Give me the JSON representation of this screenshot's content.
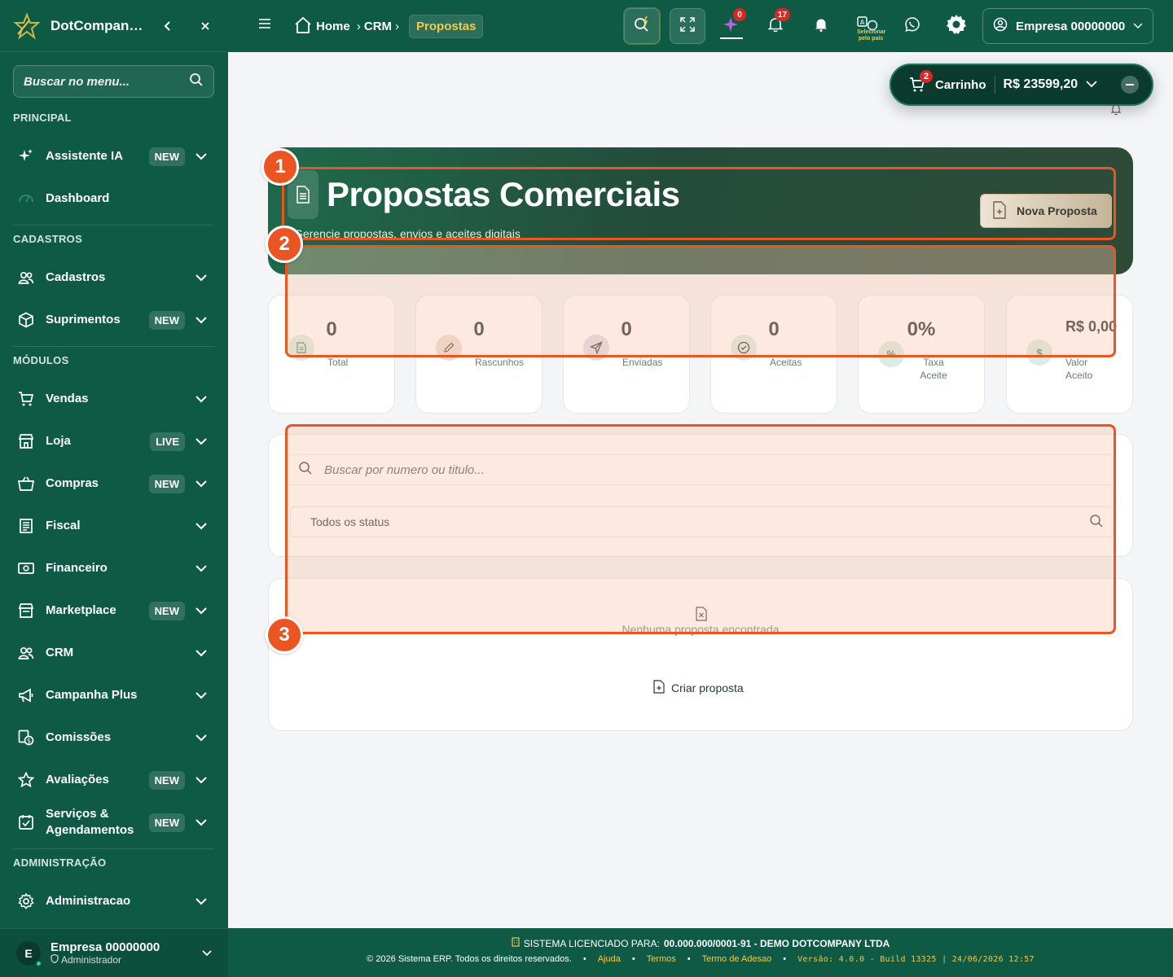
{
  "app": {
    "name": "DotCompany ERP",
    "collapse_icon": "chevron-left-icon",
    "close_icon": "close-icon"
  },
  "sidebar": {
    "search_placeholder": "Buscar no menu...",
    "sections": {
      "principal": "PRINCIPAL",
      "cadastros": "CADASTROS",
      "modulos": "MÓDULOS",
      "administracao": "ADMINISTRAÇÃO"
    },
    "items": [
      {
        "label": "Assistente IA",
        "badge": "NEW",
        "icon": "sparkle-icon"
      },
      {
        "label": "Dashboard",
        "badge": "",
        "icon": "gauge-icon"
      },
      {
        "label": "Cadastros",
        "badge": "",
        "icon": "users-icon"
      },
      {
        "label": "Suprimentos",
        "badge": "NEW",
        "icon": "box-icon"
      },
      {
        "label": "Vendas",
        "badge": "",
        "icon": "cart-icon"
      },
      {
        "label": "Loja",
        "badge": "LIVE",
        "icon": "store-icon"
      },
      {
        "label": "Compras",
        "badge": "NEW",
        "icon": "basket-icon"
      },
      {
        "label": "Fiscal",
        "badge": "",
        "icon": "receipt-icon"
      },
      {
        "label": "Financeiro",
        "badge": "",
        "icon": "cash-icon"
      },
      {
        "label": "Marketplace",
        "badge": "NEW",
        "icon": "shop-icon"
      },
      {
        "label": "CRM",
        "badge": "",
        "icon": "contacts-icon"
      },
      {
        "label": "Campanha Plus",
        "badge": "",
        "icon": "megaphone-icon"
      },
      {
        "label": "Comissões",
        "badge": "",
        "icon": "commission-icon"
      },
      {
        "label": "Avaliações",
        "badge": "NEW",
        "icon": "star-icon"
      },
      {
        "label": "Serviços & Agendamentos",
        "badge": "NEW",
        "icon": "calendar-icon"
      },
      {
        "label": "Administracao",
        "badge": "",
        "icon": "gear-icon"
      }
    ],
    "user": {
      "initial": "E",
      "name": "Empresa 00000000",
      "role": "Administrador"
    }
  },
  "topbar": {
    "breadcrumb": [
      "Home",
      "CRM",
      "Propostas"
    ],
    "notif_ai_count": "0",
    "notif_bell_count": "17",
    "translate_label": "Selecionar pelo país",
    "company": "Empresa 00000000"
  },
  "cart": {
    "count": "2",
    "label": "Carrinho",
    "total": "R$ 23599,20"
  },
  "hero": {
    "title": "Propostas Comerciais",
    "subtitle": "Gerencie propostas, envios e aceites digitais",
    "new_button": "Nova Proposta"
  },
  "stats": [
    {
      "value": "0",
      "label": "Total",
      "color": "#d9ede3",
      "icon": "document-icon"
    },
    {
      "value": "0",
      "label": "Rascunhos",
      "color": "#ecdcd4",
      "icon": "pencil-icon"
    },
    {
      "value": "0",
      "label": "Enviadas",
      "color": "#dcdce6",
      "icon": "send-icon"
    },
    {
      "value": "0",
      "label": "Aceitas",
      "color": "#d9ede3",
      "icon": "check-circle-icon"
    },
    {
      "value": "0%",
      "label": "Taxa Aceite",
      "color": "#d9ede3",
      "icon": "percent-icon"
    },
    {
      "value": "R$ 0,00",
      "label": "Valor Aceito",
      "color": "#d9ede3",
      "icon": "dollar-icon"
    }
  ],
  "filters": {
    "search_placeholder": "Buscar por numero ou titulo...",
    "status_value": "Todos os status"
  },
  "empty": {
    "text": "Nenhuma proposta encontrada",
    "create_link": "Criar proposta"
  },
  "annotations": [
    "1",
    "2",
    "3"
  ],
  "footer": {
    "license_prefix": "SISTEMA LICENCIADO PARA:",
    "license_holder": "00.000.000/0001-91 - DEMO DOTCOMPANY LTDA",
    "copyright": "© 2026 Sistema ERP. Todos os direitos reservados.",
    "links": [
      "Ajuda",
      "Termos",
      "Termo de Adesao"
    ],
    "version": "Versão: 4.0.0 - Build 13325 | 24/06/2026 12:57"
  },
  "colors": {
    "primary": "#0e5a44",
    "accent": "#f2c94c",
    "annotation": "#ea5522"
  }
}
